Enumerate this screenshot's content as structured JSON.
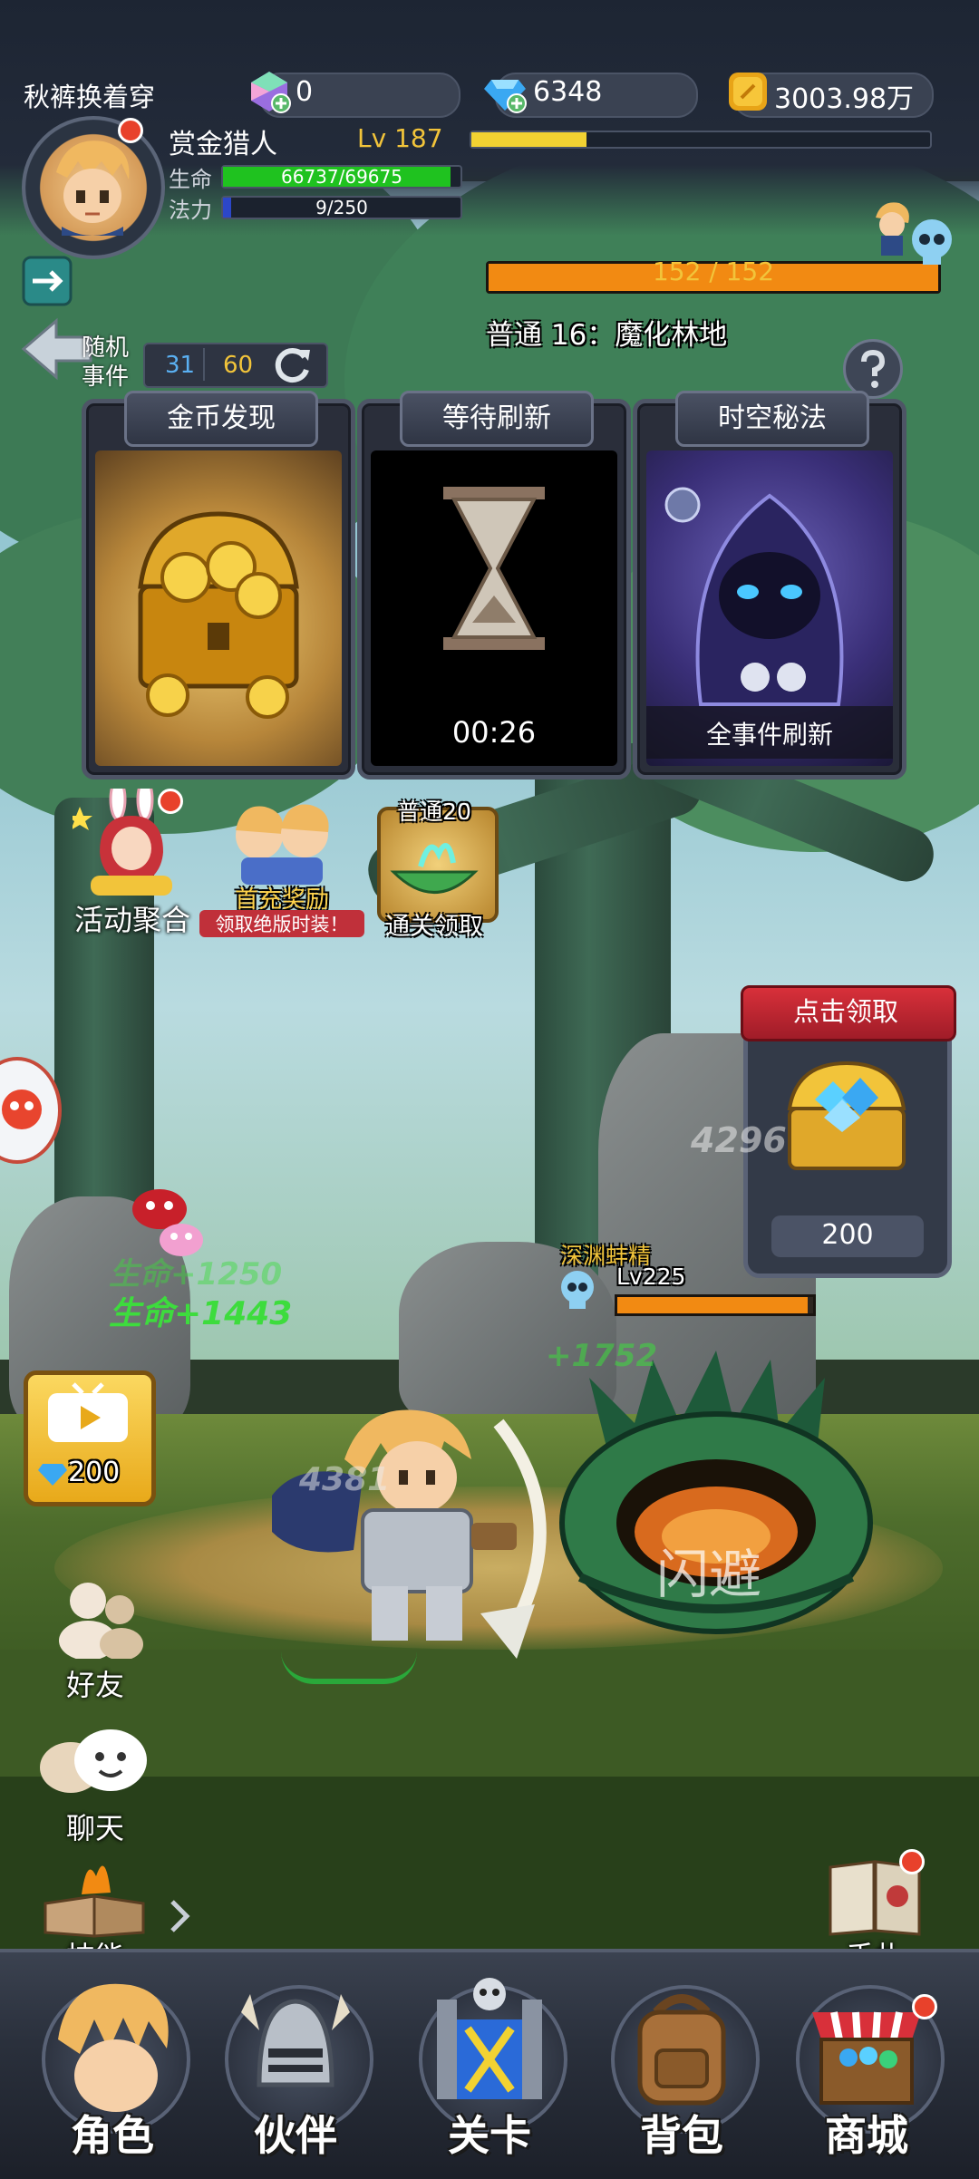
{
  "player": {
    "nickname": "秋裤换着穿",
    "class_name": "赏金猎人",
    "level_text": "Lv 187",
    "exp_fraction": 0.25,
    "hp_label": "生命",
    "hp_text": "66737/69675",
    "hp_fraction": 0.958,
    "mp_label": "法力",
    "mp_text": "9/250",
    "mp_fraction": 0.036
  },
  "resources": {
    "crystal": "0",
    "diamond": "6348",
    "gold": "3003.98万"
  },
  "stage": {
    "progress_text": "152 / 152",
    "progress_fraction": 1.0,
    "name": "普通 16：魔化林地"
  },
  "random_event": {
    "label": "随机事件",
    "count_a": "31",
    "count_b": "60"
  },
  "cards": [
    {
      "title": "金币发现",
      "footer": ""
    },
    {
      "title": "等待刷新",
      "footer": "00:26"
    },
    {
      "title": "时空秘法",
      "footer": "全事件刷新"
    }
  ],
  "promos": {
    "activity": "活动聚合",
    "first_charge_title": "首充奖励",
    "first_charge_sub": "领取绝版时装！",
    "clear_reward_top": "普通20",
    "clear_reward_bottom": "通关领取"
  },
  "claim_box": {
    "title": "点击领取",
    "amount": "200"
  },
  "video_ad": {
    "amount": "200"
  },
  "combat": {
    "enemy_name": "深渊蚌精",
    "enemy_level": "Lv225",
    "enemy_hp_fraction": 0.97,
    "float_1": "4296",
    "float_2": "生命+1250",
    "float_3": "生命+1443",
    "float_4": "+1752",
    "float_5": "4381",
    "dodge": "闪避"
  },
  "side": {
    "friends": "好友",
    "chat": "聊天",
    "skills": "技能",
    "handbook": "手札"
  },
  "nav": [
    {
      "label": "角色"
    },
    {
      "label": "伙伴"
    },
    {
      "label": "关卡"
    },
    {
      "label": "背包"
    },
    {
      "label": "商城"
    }
  ],
  "colors": {
    "hp": "#1fc21f",
    "mp": "#2c47c8",
    "exp": "#f2d232",
    "stage_bar": "#f28a12",
    "red_dot": "#e8412b"
  }
}
